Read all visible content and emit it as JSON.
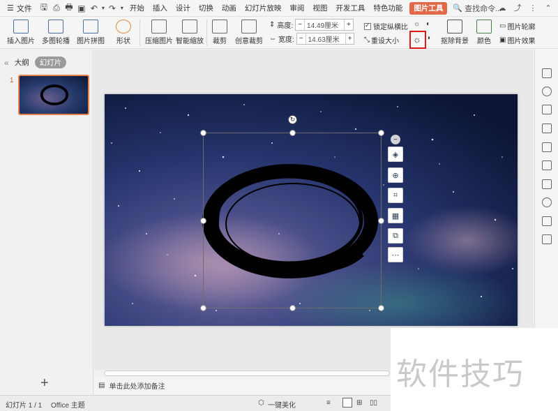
{
  "menubar": {
    "file_label": "文件",
    "tabs": [
      "开始",
      "插入",
      "设计",
      "切换",
      "动画",
      "幻灯片放映",
      "审阅",
      "视图",
      "开发工具",
      "特色功能"
    ],
    "active_tab": "图片工具",
    "search_placeholder": "查找命令..."
  },
  "ribbon": {
    "insert_picture": "插入图片",
    "multi_carousel": "多图轮播",
    "picture_collage": "图片拼图",
    "shape": "形状",
    "compress": "压缩图片",
    "smart_zoom": "智能缩放",
    "crop": "裁剪",
    "creative_crop": "创意裁剪",
    "height_label": "高度:",
    "height_value": "14.49厘米",
    "width_label": "宽度:",
    "width_value": "14.63厘米",
    "lock_ratio": "锁定纵横比",
    "reset_size": "重设大小",
    "remove_bg": "抠除背景",
    "color": "颜色",
    "pic_outline": "图片轮廓",
    "pic_effect": "图片效果",
    "minus": "−",
    "plus": "+"
  },
  "leftpanel": {
    "tab_outline": "大纲",
    "tab_slides": "幻灯片",
    "slide_number": "1"
  },
  "notes": {
    "placeholder": "单击此处添加备注"
  },
  "statusbar": {
    "slide_info": "幻灯片 1 / 1",
    "theme": "Office 主题",
    "beautify": "一键美化"
  },
  "watermark": {
    "text": "软件技巧"
  },
  "colors": {
    "accent": "#e06a48",
    "highlight": "#e01818",
    "thumb_border": "#e7834a"
  }
}
